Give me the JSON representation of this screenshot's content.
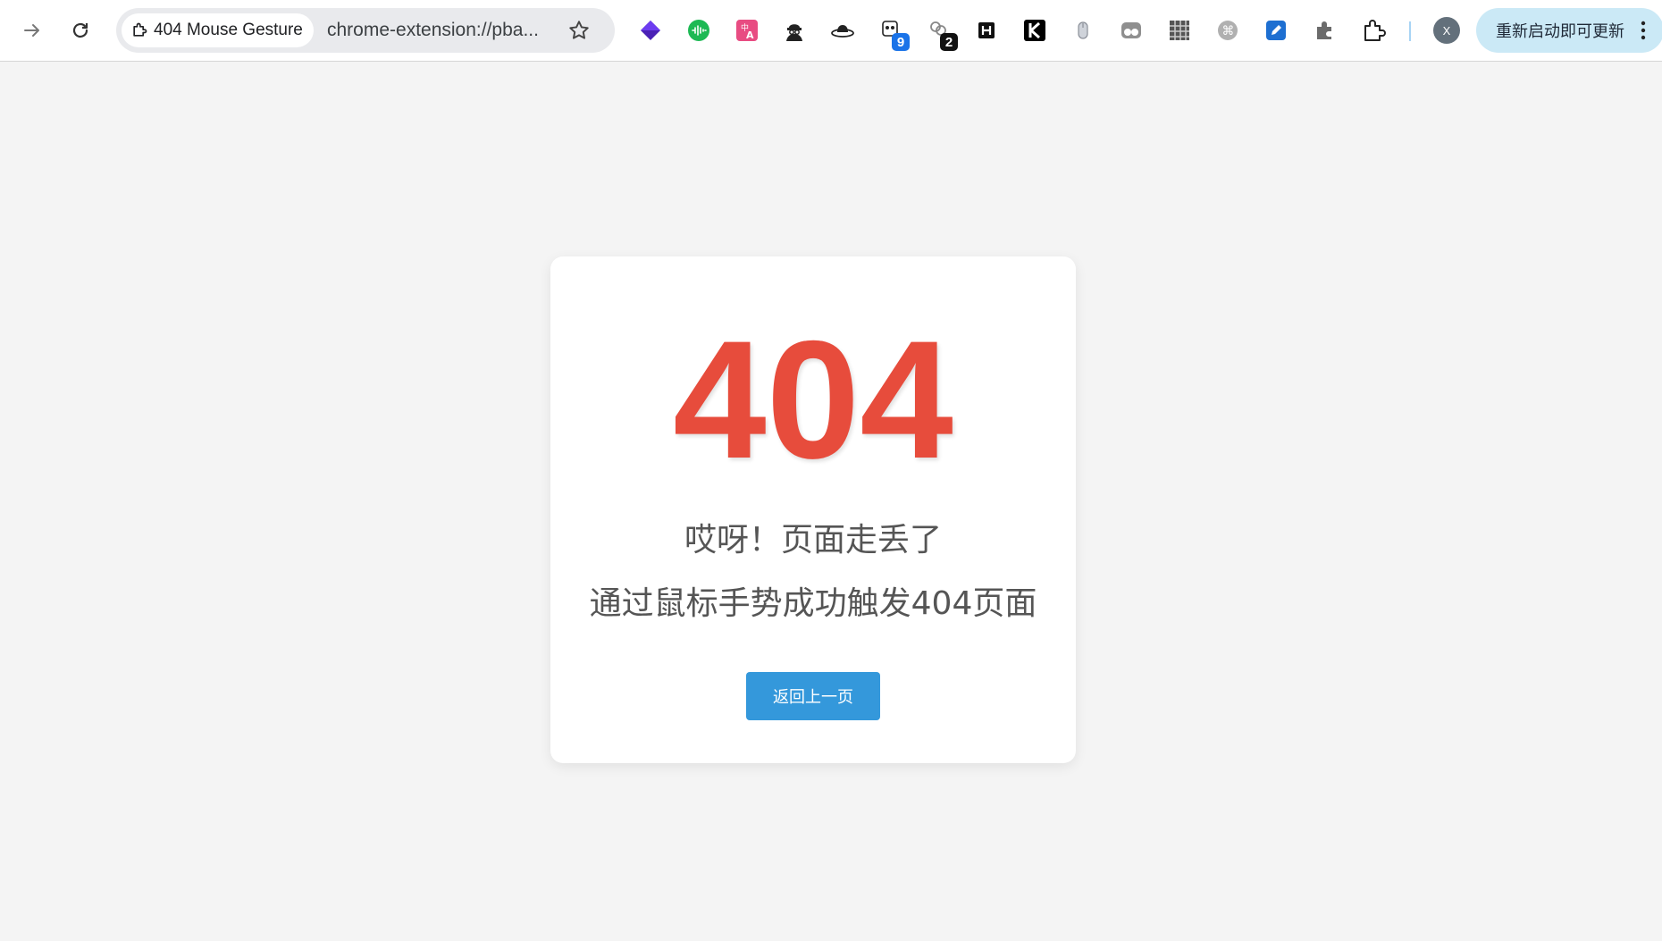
{
  "browser": {
    "tab_title": "404 Mouse Gesture",
    "url": "chrome-extension://pba...",
    "update_button_label": "重新启动即可更新",
    "profile_initial": "X",
    "extensions": [
      {
        "name": "layers-icon"
      },
      {
        "name": "audio-wave-icon"
      },
      {
        "name": "translate-icon"
      },
      {
        "name": "spy-icon"
      },
      {
        "name": "hat-icon"
      },
      {
        "name": "panda-icon",
        "badge": "9"
      },
      {
        "name": "link-icon",
        "badge": "2"
      },
      {
        "name": "h-icon"
      },
      {
        "name": "k-icon"
      },
      {
        "name": "mouse-icon"
      },
      {
        "name": "glasses-icon"
      },
      {
        "name": "pattern-icon"
      },
      {
        "name": "command-icon"
      },
      {
        "name": "edit-icon"
      },
      {
        "name": "puzzle-icon"
      },
      {
        "name": "extensions-icon"
      }
    ]
  },
  "page": {
    "error_code": "404",
    "message_primary": "哎呀！页面走丢了",
    "message_secondary": "通过鼠标手势成功触发404页面",
    "back_button_label": "返回上一页"
  },
  "colors": {
    "error_code": "#e74c3c",
    "button": "#3498db",
    "background": "#f4f4f4",
    "update_pill": "#cbe9f6"
  }
}
